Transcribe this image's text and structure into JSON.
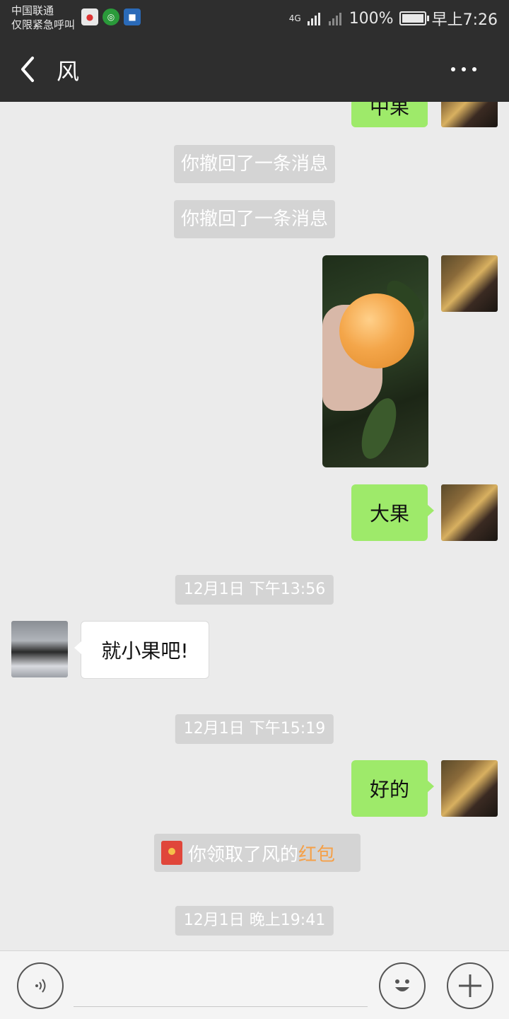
{
  "status_bar": {
    "carrier": "中国联通",
    "emergency": "仅限紧急呼叫",
    "network": "4G",
    "battery_percent": "100%",
    "time": "早上7:26"
  },
  "nav": {
    "title": "风",
    "back_icon": "chevron-left-icon",
    "more_icon": "more-icon"
  },
  "messages": {
    "partial_bubble": "中果",
    "recall_1": "你撤回了一条消息",
    "recall_2": "你撤回了一条消息",
    "big_fruit": "大果",
    "time_1": "12月1日 下午13:56",
    "small_fruit": "就小果吧!",
    "time_2": "12月1日 下午15:19",
    "ok": "好的",
    "red_packet_text": "你领取了风的",
    "red_packet_link": "红包",
    "time_3": "12月1日 晚上19:41"
  },
  "colors": {
    "my_bubble": "#9eea6a",
    "header_bg": "#2e2e2e",
    "chat_bg": "#ebebeb",
    "red_packet_link": "#f5a048"
  },
  "bottom_bar": {
    "voice_icon": "voice-icon",
    "emoji_icon": "emoji-icon",
    "plus_icon": "plus-icon"
  }
}
